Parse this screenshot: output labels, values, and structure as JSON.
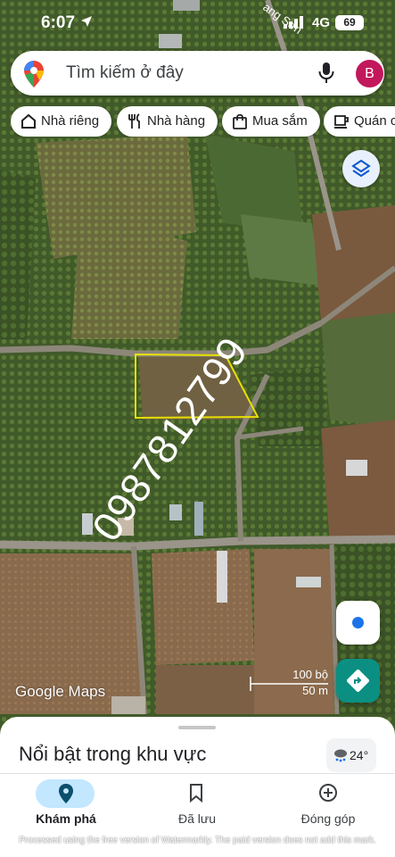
{
  "status_bar": {
    "time": "6:07",
    "network": "4G",
    "battery": "69"
  },
  "map": {
    "road_label": "ang Sơn"
  },
  "search": {
    "placeholder": "Tìm kiếm ở đây",
    "avatar_letter": "B"
  },
  "chips": [
    {
      "label": "Nhà riêng",
      "icon": "home-icon"
    },
    {
      "label": "Nhà hàng",
      "icon": "restaurant-icon"
    },
    {
      "label": "Mua sắm",
      "icon": "shopping-bag-icon"
    },
    {
      "label": "Quán c",
      "icon": "coffee-icon"
    }
  ],
  "watermark_phone": "0987812799",
  "scale": {
    "top": "100 bộ",
    "bottom": "50 m"
  },
  "google_logo": "Google Maps",
  "sheet": {
    "title": "Nổi bật trong khu vực",
    "temperature": "24°"
  },
  "nav": [
    {
      "label": "Khám phá",
      "active": true,
      "icon": "explore-pin-icon"
    },
    {
      "label": "Đã lưu",
      "active": false,
      "icon": "bookmark-icon"
    },
    {
      "label": "Đóng góp",
      "active": false,
      "icon": "add-circle-icon"
    }
  ],
  "footer_watermark": "Processed using the free version of Watermarkly. The paid version does not add this mark.",
  "colors": {
    "accent": "#1a73e8",
    "directions": "#0b8f82",
    "active_pill": "#c2e7ff",
    "parcel_outline": "#e8e000"
  }
}
